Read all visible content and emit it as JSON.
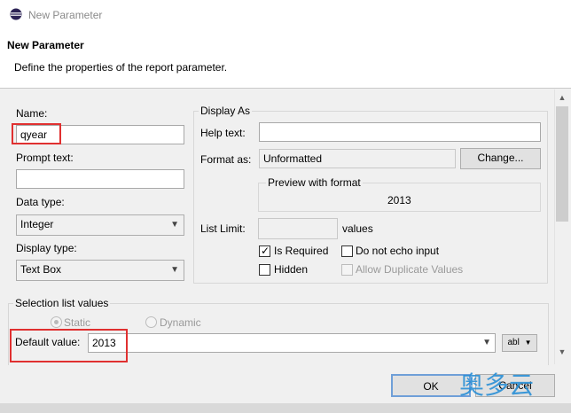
{
  "window": {
    "title": "New Parameter"
  },
  "header": {
    "title": "New Parameter",
    "description": "Define the properties of the report parameter."
  },
  "form": {
    "name_label": "Name:",
    "name_value": "qyear",
    "prompt_label": "Prompt text:",
    "prompt_value": "",
    "data_type_label": "Data type:",
    "data_type_value": "Integer",
    "display_type_label": "Display type:",
    "display_type_value": "Text Box"
  },
  "display_as": {
    "group_label": "Display As",
    "help_label": "Help text:",
    "help_value": "",
    "format_label": "Format as:",
    "format_value": "Unformatted",
    "change_button": "Change...",
    "preview_label": "Preview with format",
    "preview_value": "2013",
    "list_limit_label": "List Limit:",
    "list_limit_value": "",
    "list_limit_suffix": "values",
    "is_required_label": "Is Required",
    "is_required_checked": true,
    "do_not_echo_label": "Do not echo input",
    "do_not_echo_checked": false,
    "hidden_label": "Hidden",
    "hidden_checked": false,
    "allow_duplicate_label": "Allow Duplicate Values",
    "allow_duplicate_checked": false
  },
  "selection": {
    "group_label": "Selection list values",
    "static_label": "Static",
    "dynamic_label": "Dynamic",
    "default_label": "Default value:",
    "default_value": "2013",
    "expr_button": "abl"
  },
  "footer": {
    "ok_label": "OK",
    "cancel_label": "Cancel"
  },
  "watermark": {
    "text": "奥多云"
  },
  "colors": {
    "highlight": "#e03030",
    "watermark": "#2a8fd6"
  },
  "icons": {
    "app": "eclipse-icon",
    "dropdown": "chevron-down-icon",
    "scroll_up": "arrow-up-icon",
    "scroll_down": "arrow-down-icon"
  }
}
